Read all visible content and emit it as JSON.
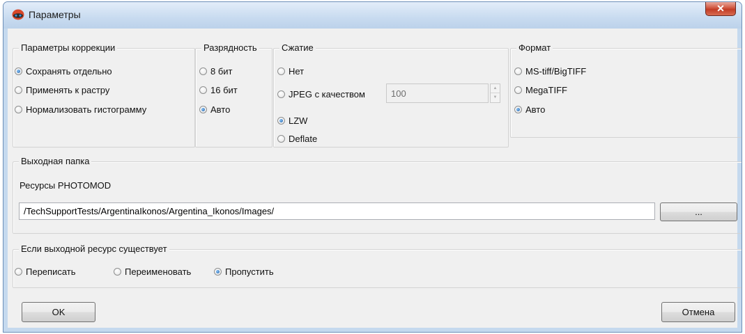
{
  "window": {
    "title": "Параметры",
    "close_glyph": "✕",
    "app_icon": "photomod-logo-icon"
  },
  "correction": {
    "title": "Параметры коррекции",
    "options": [
      "Сохранять отдельно",
      "Применять к растру",
      "Нормализовать гистограмму"
    ],
    "selected": 0
  },
  "bitdepth": {
    "title": "Разрядность",
    "options": [
      "8 бит",
      "16 бит",
      "Авто"
    ],
    "selected": 2
  },
  "compression": {
    "title": "Сжатие",
    "options": [
      "Нет",
      "JPEG с качеством",
      "LZW",
      "Deflate"
    ],
    "selected": 2,
    "quality_value": "100"
  },
  "format": {
    "title": "Формат",
    "options": [
      "MS-tiff/BigTIFF",
      "MegaTIFF",
      "Авто"
    ],
    "selected": 2
  },
  "output": {
    "title": "Выходная папка",
    "resource_label": "Ресурсы PHOTOMOD",
    "path_value": "/TechSupportTests/ArgentinaIkonos/Argentina_Ikonos/Images/",
    "browse_label": "..."
  },
  "exists": {
    "title": "Если выходной ресурс существует",
    "options": [
      "Переписать",
      "Переименовать",
      "Пропустить"
    ],
    "selected": 2
  },
  "buttons": {
    "ok": "OK",
    "cancel": "Отмена"
  }
}
